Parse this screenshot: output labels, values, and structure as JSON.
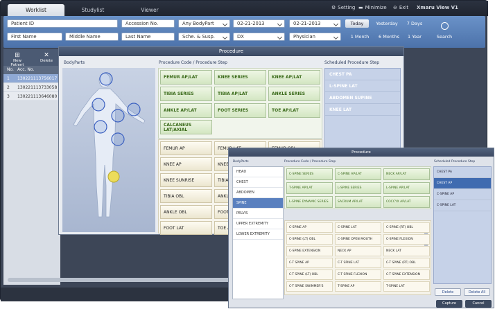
{
  "tabs": [
    "Worklist",
    "Studylist",
    "Viewer"
  ],
  "topbar": {
    "setting": "Setting",
    "minimize": "Minimize",
    "exit": "Exit",
    "brand": "Xmaru View V1"
  },
  "filter": {
    "patient_id": "Patient ID",
    "accession": "Accession No.",
    "bodypart": "Any BodyPart",
    "date_from": "02-21-2013",
    "date_to": "02-21-2013",
    "today": "Today",
    "yesterday": "Yesterday",
    "days7": "7 Days",
    "first_name": "First Name",
    "middle_name": "Middle Name",
    "last_name": "Last Name",
    "sche": "Sche. & Susp.",
    "modality": "DX",
    "physician": "Physician",
    "month1": "1 Month",
    "month6": "6 Months",
    "year1": "1 Year",
    "search": "Search"
  },
  "left": {
    "new_patient": "New Patient",
    "delete": "Delete",
    "col_no": "No.",
    "col_acc": "Acc. No.",
    "rows": [
      {
        "no": "1",
        "acc": "130221113756017"
      },
      {
        "no": "2",
        "acc": "130221113733058"
      },
      {
        "no": "3",
        "acc": "130221113646080"
      }
    ]
  },
  "proc": {
    "title": "Procedure",
    "bodyparts": "BodyParts",
    "code_step": "Procedure Code / Procedure Step",
    "sched": "Scheduled Procedure Step",
    "green": [
      "FEMUR AP/LAT",
      "KNEE SERIES",
      "KNEE AP/LAT",
      "TIBIA SERIES",
      "TIBIA AP/LAT",
      "ANKLE SERIES",
      "ANKLE AP/LAT",
      "FOOT SERIES",
      "TOE AP/LAT",
      "CALCANEUS LAT/AXIAL"
    ],
    "white": [
      "FEMUR AP",
      "FEMUR LAT",
      "FEMUR OBL",
      "KNEE AP",
      "KNEE LAT",
      "",
      "KNEE SUNRISE",
      "TIBIA AP",
      "",
      "TIBIA OBL",
      "ANKLE AP",
      "",
      "ANKLE OBL",
      "FOOT AP",
      "",
      "FOOT LAT",
      "TOE AP",
      "",
      ""
    ],
    "sched_items": [
      "CHEST PA",
      "L-SPINE LAT",
      "ABDOMEN SUPINE",
      "KNEE LAT"
    ]
  },
  "proc2": {
    "title": "Procedure",
    "bodyparts": "BodyParts",
    "code_step": "Procedure Code / Procedure Step",
    "sched": "Scheduled Procedure Step",
    "parts": [
      "HEAD",
      "CHEST",
      "ABDOMEN",
      "SPINE",
      "PELVIS",
      "UPPER EXTREMITY",
      "LOWER EXTREMITY"
    ],
    "green": [
      "C-SPINE SERIES",
      "C-SPINE AP/LAT",
      "NECK AP/LAT",
      "T-SPINE AP/LAT",
      "L-SPINE SERIES",
      "L-SPINE AP/LAT",
      "L-SPINE DYNAMIC SERIES",
      "SACRUM AP/LAT",
      "COCCYX AP/LAT"
    ],
    "white": [
      "C-SPINE AP",
      "C-SPINE LAT",
      "C-SPINE (RT) OBL",
      "C-SPINE (LT) OBL",
      "C-SPINE OPEN MOUTH",
      "C-SPINE FLEXION",
      "C-SPINE EXTENSION",
      "NECK AP",
      "NECK LAT",
      "C-T SPINE AP",
      "C-T SPINE LAT",
      "C-T SPINE (RT) OBL",
      "C-T SPINE (LT) OBL",
      "C-T SPINE FLEXION",
      "C-T SPINE EXTENSION",
      "C-T SPINE SWIMMER'S",
      "T-SPINE AP",
      "T-SPINE LAT"
    ],
    "sched_items": [
      "CHEST PA",
      "CHEST AP",
      "C-SPINE AP",
      "C-SPINE LAT"
    ],
    "delete": "Delete",
    "delete_all": "Delete All",
    "capture": "Capture",
    "cancel": "Cancel"
  }
}
